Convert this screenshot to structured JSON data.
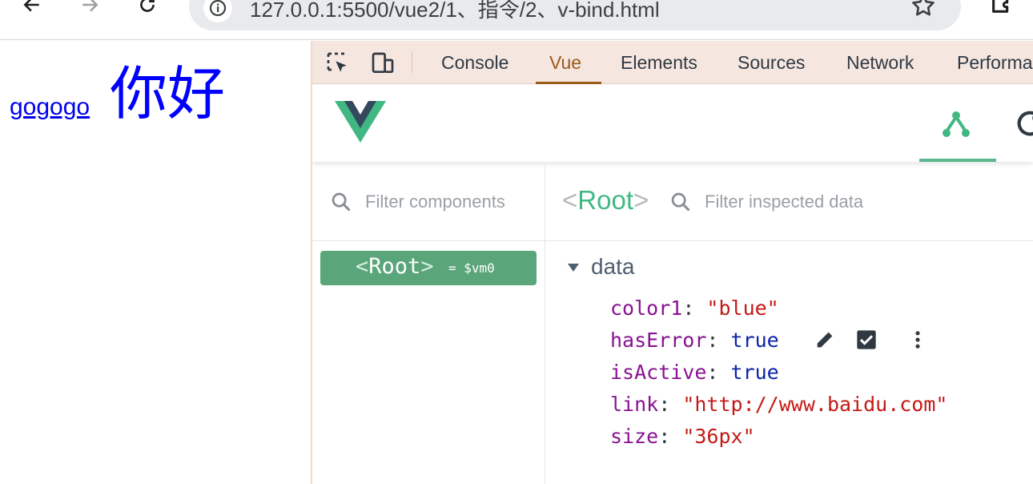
{
  "browser": {
    "url": "127.0.0.1:5500/vue2/1、指令/2、v-bind.html"
  },
  "page": {
    "link_text": "gogogo",
    "hello_text": "你好"
  },
  "devtools": {
    "tabs": [
      {
        "label": "Console"
      },
      {
        "label": "Vue"
      },
      {
        "label": "Elements"
      },
      {
        "label": "Sources"
      },
      {
        "label": "Network"
      },
      {
        "label": "Performa"
      }
    ],
    "active_tab": "Vue",
    "colors": {
      "active_tab": "#9c5b1b",
      "vue_green": "#42b983",
      "selected_row": "#5aa57a"
    }
  },
  "vue": {
    "filter_components_placeholder": "Filter components",
    "filter_data_placeholder": "Filter inspected data",
    "root_title": "Root",
    "root_component": {
      "name": "Root",
      "vm": "= $vm0"
    },
    "section_label": "data",
    "props": [
      {
        "key": "color1",
        "value": "\"blue\"",
        "type": "string"
      },
      {
        "key": "hasError",
        "value": "true",
        "type": "boolean"
      },
      {
        "key": "isActive",
        "value": "true",
        "type": "boolean"
      },
      {
        "key": "link",
        "value": "\"http://www.baidu.com\"",
        "type": "string"
      },
      {
        "key": "size",
        "value": "\"36px\"",
        "type": "string"
      }
    ]
  }
}
